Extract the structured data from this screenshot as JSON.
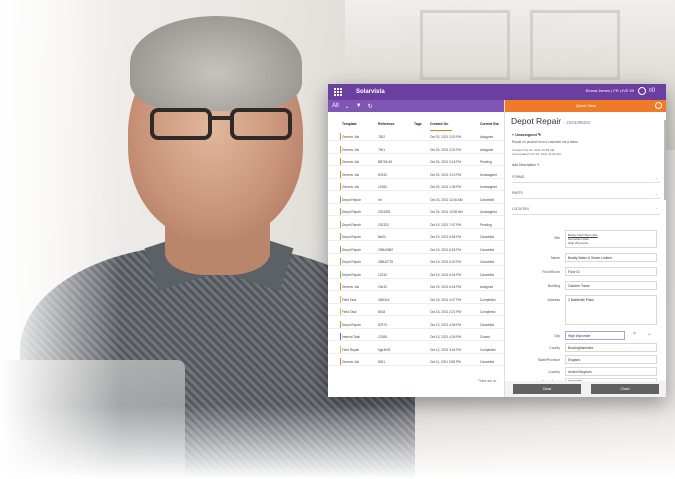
{
  "app": {
    "brand": "Solarvista",
    "user": "Emma James | FR LIVE 59",
    "notification_count": "0"
  },
  "filter": {
    "view_label": "All"
  },
  "table": {
    "headers": [
      "Template",
      "Reference",
      "Tags",
      "Created On",
      "Current Sta"
    ],
    "rows": [
      {
        "template": "Generic Job",
        "reference": "7502",
        "created": "Oct 20, 2021 3:20 PM",
        "status": "Assigned",
        "color": "#e8892b"
      },
      {
        "template": "Generic Job",
        "reference": "7501",
        "created": "Oct 20, 2021 3:20 PM",
        "status": "Assigned",
        "color": "#e8892b"
      },
      {
        "template": "Generic Job",
        "reference": "BB765-30",
        "created": "Oct 20, 2021 3:18 PM",
        "status": "Pending",
        "color": "#e8892b"
      },
      {
        "template": "Generic Job",
        "reference": "87643",
        "created": "Oct 20, 2021 3:13 PM",
        "status": "Unassigned",
        "color": "#e8892b"
      },
      {
        "template": "Generic Job",
        "reference": "12363",
        "created": "Oct 20, 2021 1:35 PM",
        "status": "Unassigned",
        "color": "#e8892b"
      },
      {
        "template": "Depot Repair",
        "reference": "Int",
        "created": "Oct 20, 2021 11:06 AM",
        "status": "Cancelled",
        "color": "#8bb34a"
      },
      {
        "template": "Depot Repair",
        "reference": "2324392",
        "created": "Oct 20, 2021 10:59 AM",
        "status": "Unassigned",
        "color": "#8bb34a"
      },
      {
        "template": "Depot Repair",
        "reference": "232332",
        "created": "Oct 19, 2021 7:07 PM",
        "status": "Pending",
        "color": "#8bb34a"
      },
      {
        "template": "Depot Repair",
        "reference": "8w04",
        "created": "Oct 19, 2021 6:55 PM",
        "status": "Cancelled",
        "color": "#8bb34a"
      },
      {
        "template": "Depot Repair",
        "reference": "23f643982",
        "created": "Oct 19, 2021 6:53 PM",
        "status": "Cancelled",
        "color": "#8bb34a"
      },
      {
        "template": "Depot Repair",
        "reference": "33f642778",
        "created": "Oct 19, 2021 6:20 PM",
        "status": "Cancelled",
        "color": "#8bb34a"
      },
      {
        "template": "Depot Repair",
        "reference": "12232",
        "created": "Oct 19, 2021 6:16 PM",
        "status": "Cancelled",
        "color": "#8bb34a"
      },
      {
        "template": "Generic Job",
        "reference": "23e32",
        "created": "Oct 19, 2021 6:16 PM",
        "status": "Assigned",
        "color": "#e8892b"
      },
      {
        "template": "Field Task",
        "reference": "43f43v3",
        "created": "Oct 15, 2021 4:07 PM",
        "status": "Completed",
        "color": "#f0b43a"
      },
      {
        "template": "Field Task",
        "reference": "8018",
        "created": "Oct 15, 2021 2:21 PM",
        "status": "Completed",
        "color": "#f0b43a"
      },
      {
        "template": "Depot Repair",
        "reference": "87574",
        "created": "Oct 13, 2021 4:08 PM",
        "status": "Cancelled",
        "color": "#8bb34a"
      },
      {
        "template": "Internal Task",
        "reference": "12365",
        "created": "Oct 13, 2021 4:26 PM",
        "status": "Closed",
        "color": "#7d5ab5"
      },
      {
        "template": "Field Repair",
        "reference": "9ge3e32",
        "created": "Oct 12, 2021 3:44 PM",
        "status": "Completed",
        "color": "#f0b43a"
      },
      {
        "template": "Generic Job",
        "reference": "8001",
        "created": "Oct 11, 2021 3:58 PM",
        "status": "Cancelled",
        "color": "#e8892b"
      }
    ],
    "footer": "There are no"
  },
  "quick_view": {
    "header": "Quick View",
    "title": "Depot Repair",
    "reference": "- 23243952st",
    "status": "Unassigned",
    "description": "Repair on product from a customer via a return.",
    "created": "Created Oct 20, 2021 10:59 AM",
    "updated": "Last updated Oct 20, 2021 11:06 AM",
    "add_description": "Add Description",
    "sections": [
      "FORMS",
      "PARTS",
      "LOCATION"
    ],
    "site": {
      "label": "Site",
      "lines": [
        "Beatty High Wycombe",
        "Gemsham Park",
        "High Wycombe"
      ]
    },
    "fields": [
      {
        "label": "Name",
        "value": "Beatty Water & Sewer Limited"
      },
      {
        "label": "Floor/Room",
        "value": "Floor 01"
      },
      {
        "label": "Building",
        "value": "Gardner Tower"
      },
      {
        "label": "Address",
        "value": "2 Babelville Place"
      }
    ],
    "city": {
      "label": "City",
      "value": "High Wycombe"
    },
    "county": {
      "label": "County",
      "value": "Buckinghamshire"
    },
    "state": {
      "label": "State/Province",
      "value": "England"
    },
    "country": {
      "label": "Country",
      "value": "United Kingdom"
    },
    "postal": {
      "label": "Postal Code",
      "value": "HP16 7TT"
    },
    "buttons": {
      "left": "Clear",
      "right": "Close"
    }
  }
}
